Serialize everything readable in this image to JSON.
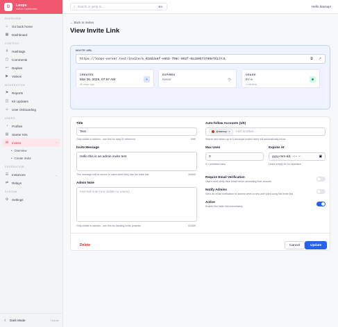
{
  "brand": {
    "name": "Loops",
    "subtitle": "Admin Dashboard",
    "logo_glyph": "D"
  },
  "sidebar": {
    "sections": [
      {
        "title": "OVERVIEW",
        "items": [
          {
            "label": "Go back home",
            "icon": "home-icon"
          },
          {
            "label": "Dashboard",
            "icon": "dashboard-icon"
          }
        ]
      },
      {
        "title": "CONTENT",
        "items": [
          {
            "label": "Hashtags",
            "icon": "hashtag-icon"
          },
          {
            "label": "Comments",
            "icon": "comment-icon"
          },
          {
            "label": "Replies",
            "icon": "reply-icon"
          },
          {
            "label": "Videos",
            "icon": "video-icon"
          }
        ]
      },
      {
        "title": "MODERATION",
        "items": [
          {
            "label": "Reports",
            "icon": "flag-icon"
          },
          {
            "label": "Kit Updates",
            "icon": "kit-icon"
          },
          {
            "label": "User Onboarding",
            "icon": "onboarding-icon"
          }
        ]
      },
      {
        "title": "USERS",
        "items": [
          {
            "label": "Profiles",
            "icon": "user-icon"
          },
          {
            "label": "Starter Kits",
            "icon": "starter-kit-icon"
          },
          {
            "label": "Invites",
            "icon": "invite-icon"
          }
        ]
      },
      {
        "title": "FEDERATION",
        "items": [
          {
            "label": "Instances",
            "icon": "server-icon"
          },
          {
            "label": "Relays",
            "icon": "relay-icon"
          }
        ]
      },
      {
        "title": "SYSTEM",
        "items": [
          {
            "label": "Settings",
            "icon": "gear-icon"
          }
        ]
      }
    ],
    "invites_sub": [
      "Overview",
      "Create Invite"
    ],
    "dark_mode_label": "Dark Mode",
    "theme_label": "Theme"
  },
  "topbar": {
    "search_placeholder": "Search or jump to...",
    "search_shortcut": "⌘K",
    "greeting": "Hello dansup!"
  },
  "page": {
    "back_link": "← Back to Invites",
    "title": "View Invite Link"
  },
  "invite_url": {
    "label": "INVITE URL",
    "value": "https://loops-server.test/invite/a_010d2a6f-e853-700c-092f-0a160b73700eTX1zYJL",
    "created_label": "CREATED",
    "created_value": "Mar 26, 2026, 07:57 AM",
    "created_sub": "36 days ago",
    "expires_label": "EXPIRES",
    "expires_value": "Never",
    "usage_label": "USAGE",
    "usage_value": "0 / ∞",
    "usage_sub": "Unlimited"
  },
  "form": {
    "title_label": "Title",
    "title_value": "Test",
    "title_help": "Only visible to admins - use this for easy ID reference",
    "title_count": "5/99",
    "message_label": "Invite Message",
    "message_value": "Hello this is an admin invite test",
    "message_help": "This message will be shown to users when they use the invite link",
    "message_count": "34/500",
    "note_label": "Admin Note",
    "note_placeholder": "Internal note (not visible to users)...",
    "note_help": "Only visible to admins - use this for tracking invite purpose",
    "note_count": "0/1000",
    "autofollow_label": "Auto-follow Accounts (1/5)",
    "autofollow_chip": "@dansup",
    "autofollow_placeholder": "Add another...",
    "autofollow_help": "Search and select up to 5 accounts invited users will automatically follow",
    "maxuses_label": "Max Uses",
    "maxuses_value": "0",
    "maxuses_help": "0 = unlimited uses",
    "expires_label": "Expires At",
    "expires_value": "yyyy-mm-dd, --:-- --",
    "expires_help": "Leave empty for no expiration",
    "verify_label": "Require Email Verification",
    "verify_help": "Users must verify their email before accessing their account",
    "verify_on": false,
    "notify_label": "Notify Admins",
    "notify_help": "Send an email notification to admins when a new user joins using this invite link",
    "notify_on": false,
    "active_label": "Active",
    "active_help": "Enable this invite link immediately",
    "active_on": true,
    "delete_label": "Delete",
    "cancel_label": "Cancel",
    "update_label": "Update"
  },
  "colors": {
    "brand": "#f0566d",
    "accent": "#2563eb",
    "danger": "#dc2626"
  }
}
